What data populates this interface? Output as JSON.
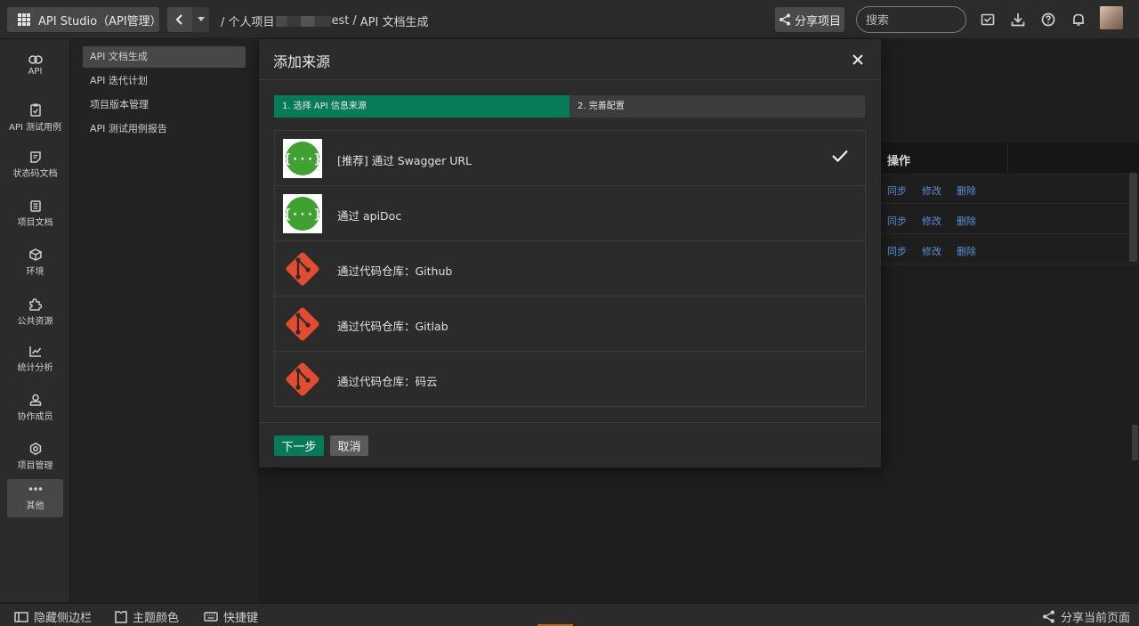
{
  "header": {
    "app_button_label": "API Studio（API管理）",
    "breadcrumb_prefix": "/ 个人项目",
    "breadcrumb_suffix": "est",
    "breadcrumb_sep": "/",
    "breadcrumb_current": "API 文档生成",
    "share_label": "分享项目",
    "search_placeholder": "搜索"
  },
  "sidebar": {
    "items": [
      {
        "label": "API",
        "icon": "link-icon"
      },
      {
        "label": "API 测试用例",
        "icon": "clipboard-check-icon"
      },
      {
        "label": "状态码文档",
        "icon": "doc-icon"
      },
      {
        "label": "项目文档",
        "icon": "document-list-icon"
      },
      {
        "label": "环境",
        "icon": "cube-icon"
      },
      {
        "label": "公共资源",
        "icon": "puzzle-icon"
      },
      {
        "label": "统计分析",
        "icon": "chart-icon"
      },
      {
        "label": "协作成员",
        "icon": "user-icon"
      },
      {
        "label": "项目管理",
        "icon": "gear-icon"
      },
      {
        "label": "其他",
        "icon": "more-icon"
      }
    ]
  },
  "subnav": {
    "items": [
      {
        "label": "API 文档生成",
        "active": true
      },
      {
        "label": "API 迭代计划",
        "active": false
      },
      {
        "label": "项目版本管理",
        "active": false
      },
      {
        "label": "API 测试用例报告",
        "active": false
      }
    ]
  },
  "table": {
    "op_header": "操作",
    "rows": [
      {
        "sync": "同步",
        "edit": "修改",
        "delete": "删除"
      },
      {
        "sync": "同步",
        "edit": "修改",
        "delete": "删除"
      },
      {
        "sync": "同步",
        "edit": "修改",
        "delete": "删除"
      }
    ]
  },
  "modal": {
    "title": "添加来源",
    "steps": [
      {
        "label": "1. 选择 API 信息来源",
        "active": true
      },
      {
        "label": "2. 完善配置",
        "active": false
      }
    ],
    "sources": [
      {
        "label": "[推荐] 通过 Swagger URL",
        "icon": "swagger-icon",
        "selected": true
      },
      {
        "label": "通过 apiDoc",
        "icon": "swagger-icon",
        "selected": false
      },
      {
        "label": "通过代码仓库：Github",
        "icon": "git-icon",
        "selected": false
      },
      {
        "label": "通过代码仓库：Gitlab",
        "icon": "git-icon",
        "selected": false
      },
      {
        "label": "通过代码仓库：码云",
        "icon": "git-icon",
        "selected": false
      }
    ],
    "next_label": "下一步",
    "cancel_label": "取消"
  },
  "bottombar": {
    "hide_sidebar": "隐藏侧边栏",
    "theme_color": "主题颜色",
    "shortcuts": "快捷键",
    "share_page": "分享当前页面"
  },
  "colors": {
    "accent": "#077a58",
    "swagger": "#3fa130",
    "git": "#e44c30",
    "link": "#5b8fd6"
  }
}
